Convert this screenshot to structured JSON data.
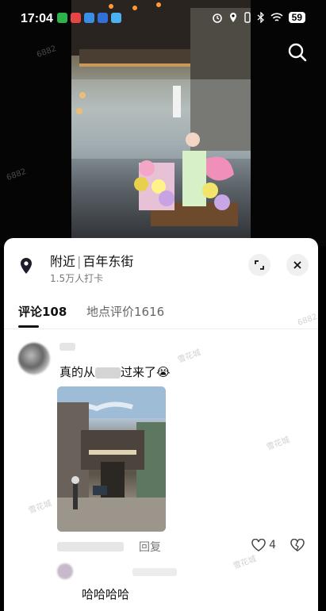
{
  "status": {
    "time": "17:04",
    "battery": "59"
  },
  "location": {
    "prefix": "附近",
    "name": "百年东街",
    "subtitle": "1.5万人打卡"
  },
  "tabs": [
    {
      "label": "评论108"
    },
    {
      "label": "地点评价1616"
    }
  ],
  "comment": {
    "text": "真的从",
    "text_suffix": "过来了😭",
    "reply_label": "回复",
    "like_count": "4"
  },
  "comment2": {
    "text": "哈哈哈哈"
  },
  "watermarks": [
    "6882",
    "6882",
    "6882",
    "雪花城",
    "雪花城",
    "雪花城",
    "雪花城"
  ],
  "colors": {
    "sheet_bg": "#ffffff",
    "accent_text": "#111111",
    "secondary_text": "#777777"
  }
}
